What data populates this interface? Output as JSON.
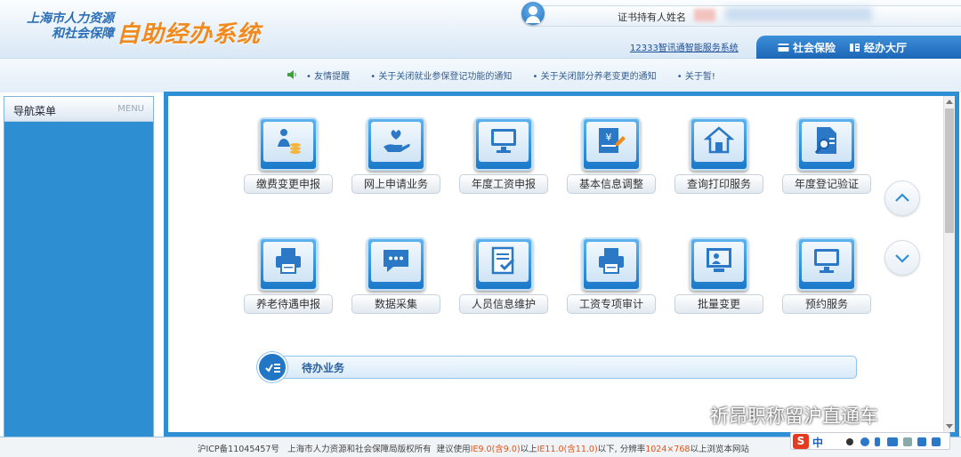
{
  "header": {
    "logo_line1": "上海市人力资源",
    "logo_line2": "和社会保障",
    "system_title": "自助经办系统",
    "cert_holder_label": "证书持有人姓名",
    "system_link": "12333智讯通智能服务系统",
    "tabs": [
      {
        "label": "社会保险"
      },
      {
        "label": "经办大厅"
      }
    ]
  },
  "notices": [
    "友情提醒",
    "关于关闭就业参保登记功能的通知",
    "关于关闭部分养老变更的通知",
    "关于暂!"
  ],
  "nav": {
    "title": "导航菜单",
    "menu_label": "MENU"
  },
  "tiles": [
    {
      "label": "缴费变更申报",
      "icon": "person-coins-icon"
    },
    {
      "label": "网上申请业务",
      "icon": "hand-heart-icon"
    },
    {
      "label": "年度工资申报",
      "icon": "monitor-icon"
    },
    {
      "label": "基本信息调整",
      "icon": "yen-edit-icon"
    },
    {
      "label": "查询打印服务",
      "icon": "house-icon"
    },
    {
      "label": "年度登记验证",
      "icon": "document-search-icon"
    },
    {
      "label": "养老待遇申报",
      "icon": "printer-icon"
    },
    {
      "label": "数据采集",
      "icon": "chat-bubble-icon"
    },
    {
      "label": "人员信息维护",
      "icon": "checklist-icon"
    },
    {
      "label": "工资专项审计",
      "icon": "printer-icon"
    },
    {
      "label": "批量变更",
      "icon": "presentation-icon"
    },
    {
      "label": "预约服务",
      "icon": "monitor-icon"
    }
  ],
  "pending": {
    "title": "待办业务"
  },
  "footer": {
    "icp": "沪ICP备11045457号",
    "copyright": "上海市人力资源和社会保障局版权所有",
    "advice_prefix": "建议使用",
    "ie9": "IE9.0(含9.0)",
    "above": "以上",
    "ie11": "IE11.0(含11.0)",
    "below_res": "以下, 分辨率",
    "resolution": "1024×768",
    "advice_suffix": "以上浏览本网站"
  },
  "watermark": "祈昂职称留沪直通车",
  "ime": {
    "brand": "S",
    "mode": "中"
  },
  "colors": {
    "accent": "#2e8fd4",
    "logo_orange": "#f08a1e",
    "nav_blue": "#2d8fd2"
  }
}
